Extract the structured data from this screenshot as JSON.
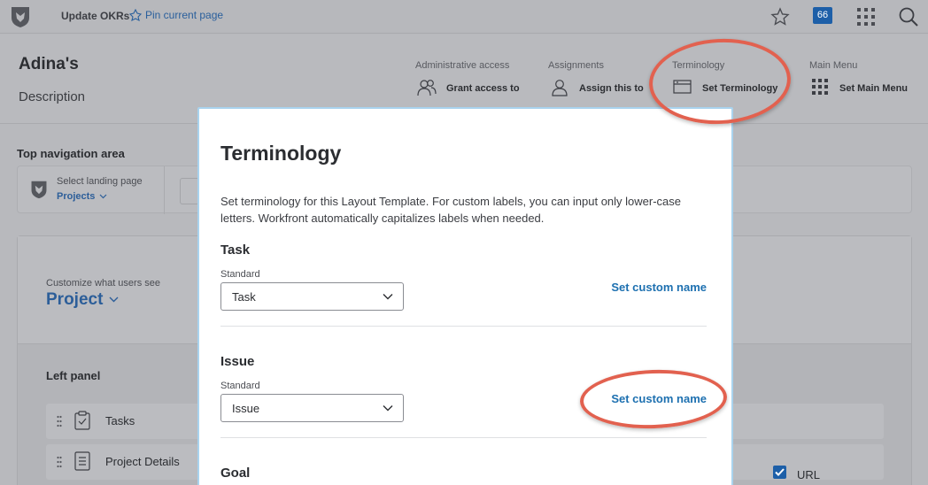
{
  "topbar": {
    "title": "Update OKRs",
    "pin_label": "Pin current page",
    "notification_count": "66"
  },
  "header": {
    "page_name": "Adina's",
    "description": "Description",
    "columns": [
      {
        "label": "Administrative access",
        "action": "Grant access to"
      },
      {
        "label": "Assignments",
        "action": "Assign this to"
      },
      {
        "label": "Terminology",
        "action": "Set Terminology"
      },
      {
        "label": "Main Menu",
        "action": "Set Main Menu"
      }
    ]
  },
  "top_nav": {
    "title": "Top navigation area",
    "select_landing": "Select landing page",
    "landing_value": "Projects"
  },
  "main": {
    "customize_label": "Customize what users see",
    "object_value": "Project",
    "left_panel": "Left panel",
    "rows": [
      {
        "label": "Tasks"
      },
      {
        "label": "Project Details"
      }
    ],
    "url_label": "URL"
  },
  "modal": {
    "title": "Terminology",
    "description": "Set terminology for this Layout Template. For custom labels, you can input only lower-case letters. Workfront automatically capitalizes labels when needed.",
    "sections": [
      {
        "name": "Task",
        "standard_label": "Standard",
        "value": "Task",
        "custom_label": "Set custom name"
      },
      {
        "name": "Issue",
        "standard_label": "Standard",
        "value": "Issue",
        "custom_label": "Set custom name"
      },
      {
        "name": "Goal"
      }
    ]
  },
  "colors": {
    "accent": "#1d70b0",
    "badge": "#1d5fa8",
    "annotation": "#e2614f",
    "modal_border": "#a9d3ee"
  }
}
